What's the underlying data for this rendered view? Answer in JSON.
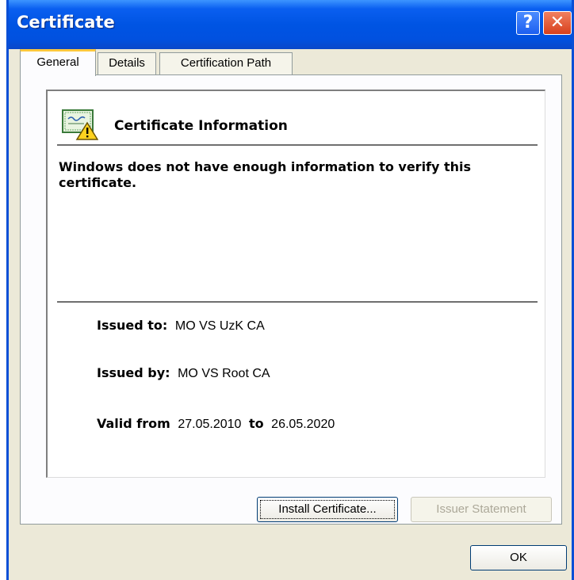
{
  "window": {
    "title": "Certificate",
    "help_label": "?",
    "close_label": "✕"
  },
  "tabs": [
    {
      "label": "General",
      "active": true
    },
    {
      "label": "Details",
      "active": false
    },
    {
      "label": "Certification Path",
      "active": false
    }
  ],
  "info": {
    "icon": "certificate-warning-icon",
    "header": "Certificate Information",
    "warning": "Windows does not have enough information to verify this certificate.",
    "issued_to_label": "Issued to:",
    "issued_to_value": "MO VS UzK CA",
    "issued_by_label": "Issued by:",
    "issued_by_value": "MO VS Root CA",
    "valid_from_label": "Valid from",
    "valid_from_value": "27.05.2010",
    "valid_to_label": "to",
    "valid_to_value": "26.05.2020"
  },
  "buttons": {
    "install": "Install Certificate...",
    "issuer": "Issuer Statement",
    "ok": "OK"
  },
  "colors": {
    "titlebar": "#0054e3",
    "face": "#ece9d8",
    "active_tab_accent": "#ffc83c"
  }
}
